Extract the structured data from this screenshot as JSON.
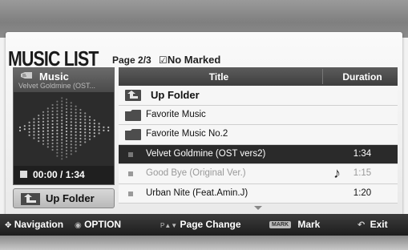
{
  "header": {
    "title": "MUSIC LIST",
    "page": "Page 2/3",
    "marked": "No Marked"
  },
  "now_playing": {
    "category": "Music",
    "track": "Velvet Goldmine (OST...",
    "time": "00:00 / 1:34"
  },
  "up_folder_button": {
    "label": "Up Folder"
  },
  "table": {
    "columns": {
      "title": "Title",
      "duration": "Duration"
    },
    "rows": [
      {
        "kind": "up",
        "name": "Up Folder",
        "duration": ""
      },
      {
        "kind": "folder",
        "name": "Favorite Music",
        "duration": ""
      },
      {
        "kind": "folder",
        "name": "Favorite Music No.2",
        "duration": ""
      },
      {
        "kind": "file",
        "name": "Velvet Goldmine (OST vers2)",
        "duration": "1:34",
        "selected": true
      },
      {
        "kind": "file",
        "name": "Good Bye (Original Ver.)",
        "duration": "1:15",
        "playing": true
      },
      {
        "kind": "file",
        "name": "Urban Nite (Feat.Amin.J)",
        "duration": "1:20"
      }
    ]
  },
  "navbar": {
    "navigation": "Navigation",
    "option": "OPTION",
    "page_change": "Page Change",
    "mark_key": "MARK",
    "mark": "Mark",
    "exit": "Exit"
  },
  "colors": {
    "selected_row": "#2a2a2a",
    "header_bar": "#4a4a4a",
    "navbar": "#2a2a2a"
  }
}
